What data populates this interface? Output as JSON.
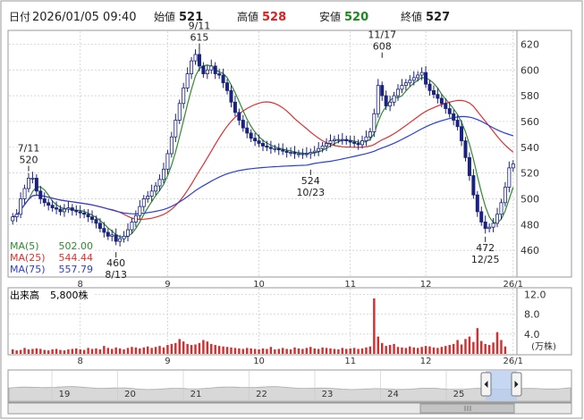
{
  "header": {
    "date_label": "日付",
    "date_value": "2026/01/05 09:40",
    "open_label": "始値",
    "open_value": "521",
    "high_label": "高値",
    "high_value": "528",
    "low_label": "安値",
    "low_value": "520",
    "close_label": "終値",
    "close_value": "527"
  },
  "legend": [
    {
      "label": "MA(5)",
      "value": "502.00",
      "color": "#2e8b2e"
    },
    {
      "label": "MA(25)",
      "value": "544.44",
      "color": "#e03030"
    },
    {
      "label": "MA(75)",
      "value": "557.79",
      "color": "#2a3fd8"
    }
  ],
  "volume_panel": {
    "label": "出来高",
    "value": "5,800株",
    "unit": "(万株)"
  },
  "colors": {
    "candle_up": "#ffffff",
    "candle_down": "#1a237e",
    "volume_bar": "#d03030",
    "grid": "#c8c8c8",
    "navigator_fill": "#d8d8d8",
    "navigator_selected": "#b8cdf0"
  },
  "navigator": {
    "labels": [
      "19",
      "20",
      "21",
      "22",
      "23",
      "24",
      "25"
    ]
  },
  "chart_data": {
    "type": "candlestick",
    "price_axis": {
      "ylim": [
        440,
        630
      ],
      "ticks": [
        460,
        480,
        500,
        520,
        540,
        560,
        580,
        600,
        620
      ]
    },
    "volume_axis": {
      "ylim": [
        0,
        13
      ],
      "ticks": [
        "4.0",
        "8.0",
        "12.0"
      ]
    },
    "x_ticks": [
      {
        "label": "8",
        "day": 17
      },
      {
        "label": "9",
        "day": 39
      },
      {
        "label": "10",
        "day": 62
      },
      {
        "label": "11",
        "day": 85
      },
      {
        "label": "12",
        "day": 104
      },
      {
        "label": "26/1",
        "day": 126
      }
    ],
    "annotations": [
      {
        "type": "high",
        "date": "7/11",
        "value": "520",
        "day": 4
      },
      {
        "type": "low",
        "date": "8/13",
        "value": "460",
        "day": 26
      },
      {
        "type": "high",
        "date": "9/11",
        "value": "615",
        "day": 47
      },
      {
        "type": "low",
        "date": "10/23",
        "value": "524",
        "day": 75
      },
      {
        "type": "high",
        "date": "11/17",
        "value": "608",
        "day": 93
      },
      {
        "type": "low",
        "date": "12/25",
        "value": "472",
        "day": 119
      }
    ],
    "close": [
      486,
      488,
      500,
      508,
      516,
      516,
      506,
      500,
      497,
      495,
      493,
      492,
      490,
      492,
      493,
      491,
      490,
      489,
      488,
      486,
      484,
      481,
      477,
      474,
      471,
      472,
      467,
      469,
      471,
      476,
      482,
      487,
      494,
      500,
      502,
      506,
      510,
      515,
      523,
      535,
      548,
      561,
      574,
      586,
      597,
      607,
      612,
      603,
      597,
      600,
      603,
      597,
      596,
      590,
      584,
      575,
      567,
      561,
      555,
      551,
      547,
      545,
      543,
      541,
      540,
      539,
      539,
      538,
      537,
      536,
      536,
      535,
      535,
      535,
      535,
      536,
      537,
      539,
      541,
      543,
      545,
      546,
      546,
      546,
      545,
      544,
      543,
      542,
      545,
      548,
      552,
      566,
      588,
      580,
      572,
      575,
      580,
      585,
      588,
      590,
      592,
      594,
      596,
      598,
      589,
      584,
      581,
      578,
      574,
      570,
      566,
      561,
      556,
      545,
      532,
      518,
      503,
      490,
      482,
      477,
      478,
      481,
      488,
      497,
      509,
      524,
      527
    ],
    "volume": [
      0.9,
      0.7,
      0.8,
      1.2,
      0.9,
      1.0,
      1.1,
      1.0,
      0.8,
      0.7,
      0.9,
      1.0,
      0.8,
      0.7,
      0.9,
      1.0,
      1.1,
      0.9,
      0.8,
      1.2,
      1.0,
      1.1,
      0.9,
      1.6,
      1.2,
      1.0,
      1.3,
      1.1,
      0.9,
      1.2,
      1.4,
      1.3,
      1.1,
      1.3,
      1.5,
      1.2,
      1.4,
      1.6,
      1.3,
      1.8,
      2.0,
      2.2,
      3.0,
      2.5,
      2.0,
      1.8,
      1.9,
      2.2,
      2.8,
      2.5,
      2.0,
      1.8,
      1.6,
      1.5,
      1.4,
      1.3,
      1.2,
      1.1,
      1.0,
      1.2,
      1.1,
      1.0,
      0.9,
      1.1,
      1.0,
      1.4,
      0.9,
      1.0,
      1.2,
      1.0,
      0.9,
      1.3,
      1.1,
      1.0,
      1.2,
      1.4,
      1.1,
      1.0,
      1.3,
      1.2,
      1.1,
      1.0,
      0.9,
      1.2,
      1.0,
      1.1,
      1.2,
      1.0,
      1.1,
      1.3,
      1.5,
      11.2,
      3.5,
      2.2,
      1.6,
      1.8,
      2.0,
      1.4,
      1.3,
      1.2,
      1.5,
      1.3,
      1.2,
      1.4,
      1.6,
      1.5,
      1.3,
      1.2,
      1.4,
      1.6,
      1.8,
      2.0,
      2.8,
      1.9,
      3.0,
      3.5,
      2.4,
      5.2,
      2.6,
      2.0,
      1.8,
      2.3,
      4.4,
      2.8,
      1.5
    ]
  }
}
